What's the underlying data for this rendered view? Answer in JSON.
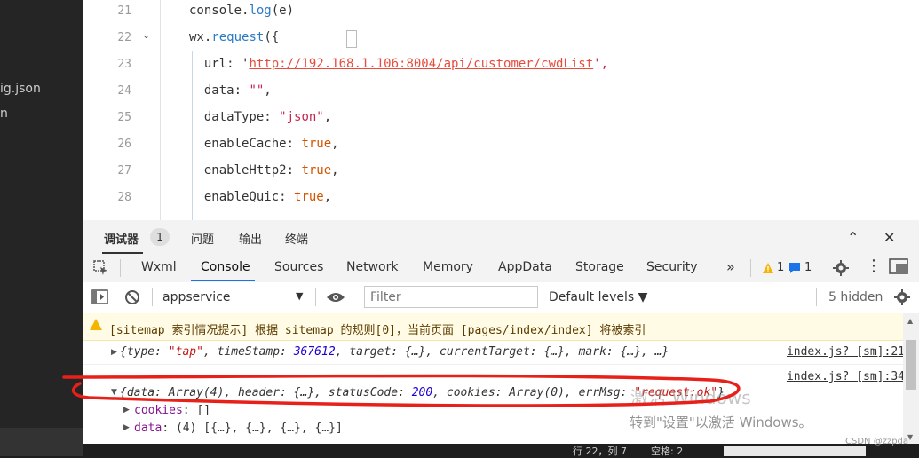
{
  "explorer": {
    "items": [
      "ig.json",
      "n"
    ]
  },
  "editor": {
    "line_numbers": [
      "21",
      "22",
      "23",
      "24",
      "25",
      "26",
      "27",
      "28"
    ],
    "lines": [
      {
        "parts": [
          {
            "t": "console.",
            "c": "k"
          },
          {
            "t": "log",
            "c": "f"
          },
          {
            "t": "(e)",
            "c": "k"
          }
        ]
      },
      {
        "parts": [
          {
            "t": "wx.",
            "c": "k"
          },
          {
            "t": "request",
            "c": "f"
          },
          {
            "t": "({",
            "c": "k"
          }
        ]
      },
      {
        "parts": [
          {
            "t": "  url: '",
            "c": "k"
          },
          {
            "t": "http://192.168.1.106:8004/api/customer/cwdList",
            "c": "u"
          },
          {
            "t": "',",
            "c": "s"
          }
        ]
      },
      {
        "parts": [
          {
            "t": "  data: ",
            "c": "k"
          },
          {
            "t": "\"\"",
            "c": "s"
          },
          {
            "t": ",",
            "c": "k"
          }
        ]
      },
      {
        "parts": [
          {
            "t": "  dataType: ",
            "c": "k"
          },
          {
            "t": "\"json\"",
            "c": "s"
          },
          {
            "t": ",",
            "c": "k"
          }
        ]
      },
      {
        "parts": [
          {
            "t": "  enableCache: ",
            "c": "k"
          },
          {
            "t": "true",
            "c": "b"
          },
          {
            "t": ",",
            "c": "k"
          }
        ]
      },
      {
        "parts": [
          {
            "t": "  enableHttp2: ",
            "c": "k"
          },
          {
            "t": "true",
            "c": "b"
          },
          {
            "t": ",",
            "c": "k"
          }
        ]
      },
      {
        "parts": [
          {
            "t": "  enableQuic: ",
            "c": "k"
          },
          {
            "t": "true",
            "c": "b"
          },
          {
            "t": ",",
            "c": "k"
          }
        ]
      }
    ]
  },
  "panel": {
    "tabs": [
      "调试器",
      "问题",
      "输出",
      "终端"
    ],
    "debugger_badge": "1",
    "minimize_icon": "chevron-up-icon",
    "close_icon": "close-icon"
  },
  "devtools": {
    "tabs": [
      "Wxml",
      "Console",
      "Sources",
      "Network",
      "Memory",
      "AppData",
      "Storage",
      "Security"
    ],
    "active_tab": "Console",
    "more": "»",
    "warn_count": "1",
    "msg_count": "1"
  },
  "filter": {
    "context": "appservice",
    "placeholder": "Filter",
    "levels": "Default levels ▼",
    "hidden": "5 hidden"
  },
  "console": {
    "warning": "[sitemap 索引情况提示] 根据 sitemap 的规则[0]，当前页面 [pages/index/index] 将被索引",
    "row1": {
      "text_parts": [
        {
          "t": "{type: ",
          "c": ""
        },
        {
          "t": "\"tap\"",
          "c": "str"
        },
        {
          "t": ", timeStamp: ",
          "c": ""
        },
        {
          "t": "367612",
          "c": "num"
        },
        {
          "t": ", target: {…}, currentTarget: {…}, mark: {…}, …}",
          "c": ""
        }
      ],
      "source": "index.js? [sm]:21"
    },
    "row2": {
      "text_parts": [
        {
          "t": "{data: Array(4), header: {…}, statusCode: ",
          "c": ""
        },
        {
          "t": "200",
          "c": "num"
        },
        {
          "t": ", cookies: Array(0), errMsg: ",
          "c": ""
        },
        {
          "t": "\"request:ok\"",
          "c": "str"
        },
        {
          "t": "}",
          "c": ""
        }
      ],
      "source": "index.js? [sm]:34"
    },
    "sub1": {
      "key": "cookies",
      "value": ": []"
    },
    "sub2": {
      "key": "data",
      "value": ": (4) [{…}, {…}, {…}, {…}]"
    }
  },
  "watermark": {
    "line1": "激活 Windows",
    "line2": "转到\"设置\"以激活 Windows。"
  },
  "csdn": "CSDN @zzpda",
  "statusbar": [
    "行 22，列 7",
    "空格: 2"
  ]
}
